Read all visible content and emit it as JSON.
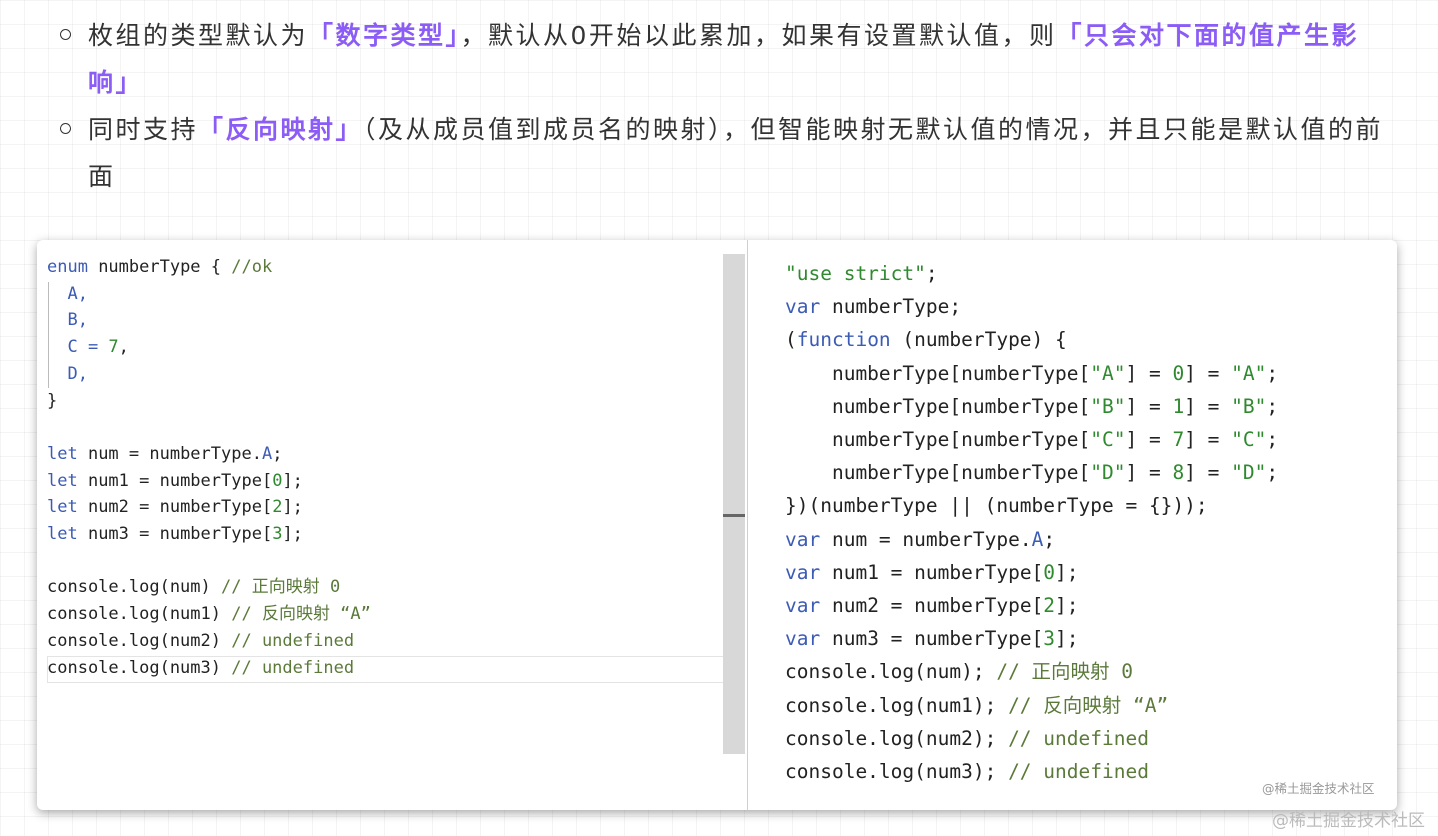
{
  "bullets": [
    {
      "t1": "枚组的类型默认为",
      "h1": "「数字类型」",
      "t2": "，默认从0开始以此累加，如果有设置默认值，则",
      "h2": "「只会对下面的值产生影响」"
    },
    {
      "t1": "同时支持",
      "h1": "「反向映射」",
      "t2": "（及从成员值到成员名的映射），但智能映射无默认值的情况，并且只能是默认值的前面"
    }
  ],
  "left_code": {
    "l1_kw": "enum",
    "l1_a": " numberType { ",
    "l1_cm": "//ok",
    "l2": "  A,",
    "l3": "  B,",
    "l4_a": "  C = ",
    "l4_n": "7",
    "l4_b": ",",
    "l5": "  D,",
    "l6": "}",
    "let": "let",
    "l8_a": " num = numberType.",
    "l8_p": "A",
    "l8_b": ";",
    "l9_a": " num1 = numberType[",
    "l9_n": "0",
    "l9_b": "];",
    "l10_a": " num2 = numberType[",
    "l10_n": "2",
    "l10_b": "];",
    "l11_a": " num3 = numberType[",
    "l11_n": "3",
    "l11_b": "];",
    "l13_a": "console.log(num) ",
    "l13_c": "// 正向映射 0",
    "l14_a": "console.log(num1) ",
    "l14_c": "// 反向映射 “A”",
    "l15_a": "console.log(num2) ",
    "l15_c": "// undefined",
    "l16_a": "console.log(num3) ",
    "l16_c": "// undefined"
  },
  "right_code": {
    "r1": "\"use strict\"",
    "r1b": ";",
    "var": "var",
    "r2": " numberType;",
    "r3_a": "(",
    "r3_kw": "function",
    "r3_b": " (numberType) {",
    "r_ind": "    numberType[numberType[",
    "sA": "\"A\"",
    "sB": "\"B\"",
    "sC": "\"C\"",
    "sD": "\"D\"",
    "eq": "] = ",
    "eq2": "] = ",
    "n0": "0",
    "n1": "1",
    "n7": "7",
    "n8": "8",
    "semi": ";",
    "r8": "})(numberType || (numberType = {}));",
    "r9_a": " num = numberType.",
    "r9_p": "A",
    "r9_b": ";",
    "r10_a": " num1 = numberType[",
    "r10_n": "0",
    "r10_b": "];",
    "r11_a": " num2 = numberType[",
    "r11_n": "2",
    "r11_b": "];",
    "r12_a": " num3 = numberType[",
    "r12_n": "3",
    "r12_b": "];",
    "r13_a": "console.log(num); ",
    "r13_c": "// 正向映射 0",
    "r14_a": "console.log(num1); ",
    "r14_c": "// 反向映射 “A”",
    "r15_a": "console.log(num2); ",
    "r15_c": "// undefined",
    "r16_a": "console.log(num3); ",
    "r16_c": "// undefined"
  },
  "watermark_inner": "@稀土掘金技术社区",
  "watermark_outer": "@稀土掘金技术社区"
}
